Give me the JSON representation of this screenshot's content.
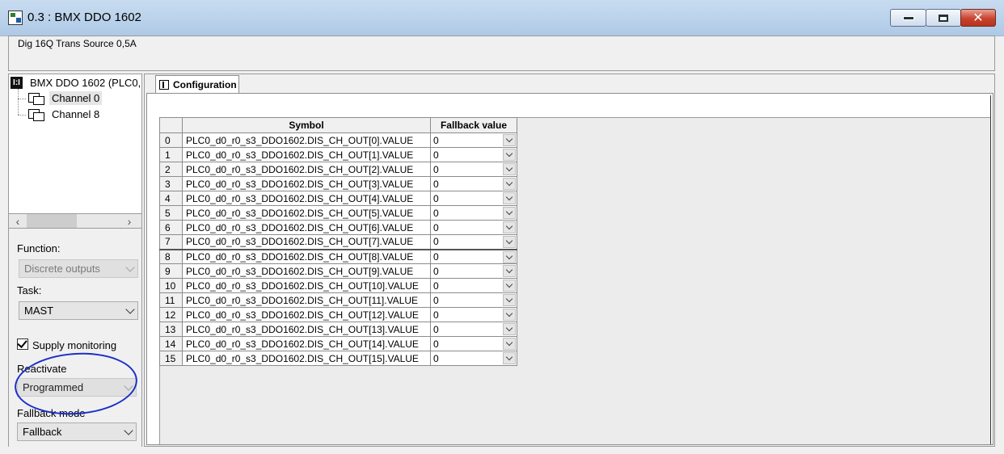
{
  "window": {
    "title": "0.3 : BMX DDO 1602",
    "description": "Dig 16Q Trans Source 0,5A"
  },
  "tree": {
    "root_label": "BMX DDO 1602 (PLC0,",
    "items": [
      {
        "label": "Channel 0",
        "selected": true
      },
      {
        "label": "Channel 8",
        "selected": false
      }
    ]
  },
  "left_panel": {
    "function_label": "Function:",
    "function_value": "Discrete outputs",
    "task_label": "Task:",
    "task_value": "MAST",
    "supply_monitoring_label": "Supply monitoring",
    "supply_monitoring_checked": true,
    "reactivate_label": "Reactivate",
    "reactivate_value": "Programmed",
    "fallback_mode_label": "Fallback mode",
    "fallback_mode_value": "Fallback"
  },
  "tabs": [
    {
      "label": "Configuration",
      "active": true
    }
  ],
  "table": {
    "headers": {
      "index": "",
      "symbol": "Symbol",
      "fallback": "Fallback value"
    },
    "rows": [
      {
        "index": "0",
        "symbol": "PLC0_d0_r0_s3_DDO1602.DIS_CH_OUT[0].VALUE",
        "fallback": "0"
      },
      {
        "index": "1",
        "symbol": "PLC0_d0_r0_s3_DDO1602.DIS_CH_OUT[1].VALUE",
        "fallback": "0"
      },
      {
        "index": "2",
        "symbol": "PLC0_d0_r0_s3_DDO1602.DIS_CH_OUT[2].VALUE",
        "fallback": "0"
      },
      {
        "index": "3",
        "symbol": "PLC0_d0_r0_s3_DDO1602.DIS_CH_OUT[3].VALUE",
        "fallback": "0"
      },
      {
        "index": "4",
        "symbol": "PLC0_d0_r0_s3_DDO1602.DIS_CH_OUT[4].VALUE",
        "fallback": "0"
      },
      {
        "index": "5",
        "symbol": "PLC0_d0_r0_s3_DDO1602.DIS_CH_OUT[5].VALUE",
        "fallback": "0"
      },
      {
        "index": "6",
        "symbol": "PLC0_d0_r0_s3_DDO1602.DIS_CH_OUT[6].VALUE",
        "fallback": "0"
      },
      {
        "index": "7",
        "symbol": "PLC0_d0_r0_s3_DDO1602.DIS_CH_OUT[7].VALUE",
        "fallback": "0"
      },
      {
        "index": "8",
        "symbol": "PLC0_d0_r0_s3_DDO1602.DIS_CH_OUT[8].VALUE",
        "fallback": "0"
      },
      {
        "index": "9",
        "symbol": "PLC0_d0_r0_s3_DDO1602.DIS_CH_OUT[9].VALUE",
        "fallback": "0"
      },
      {
        "index": "10",
        "symbol": "PLC0_d0_r0_s3_DDO1602.DIS_CH_OUT[10].VALUE",
        "fallback": "0"
      },
      {
        "index": "11",
        "symbol": "PLC0_d0_r0_s3_DDO1602.DIS_CH_OUT[11].VALUE",
        "fallback": "0"
      },
      {
        "index": "12",
        "symbol": "PLC0_d0_r0_s3_DDO1602.DIS_CH_OUT[12].VALUE",
        "fallback": "0"
      },
      {
        "index": "13",
        "symbol": "PLC0_d0_r0_s3_DDO1602.DIS_CH_OUT[13].VALUE",
        "fallback": "0"
      },
      {
        "index": "14",
        "symbol": "PLC0_d0_r0_s3_DDO1602.DIS_CH_OUT[14].VALUE",
        "fallback": "0"
      },
      {
        "index": "15",
        "symbol": "PLC0_d0_r0_s3_DDO1602.DIS_CH_OUT[15].VALUE",
        "fallback": "0"
      }
    ]
  },
  "annotation_color": "#1a2fc8"
}
